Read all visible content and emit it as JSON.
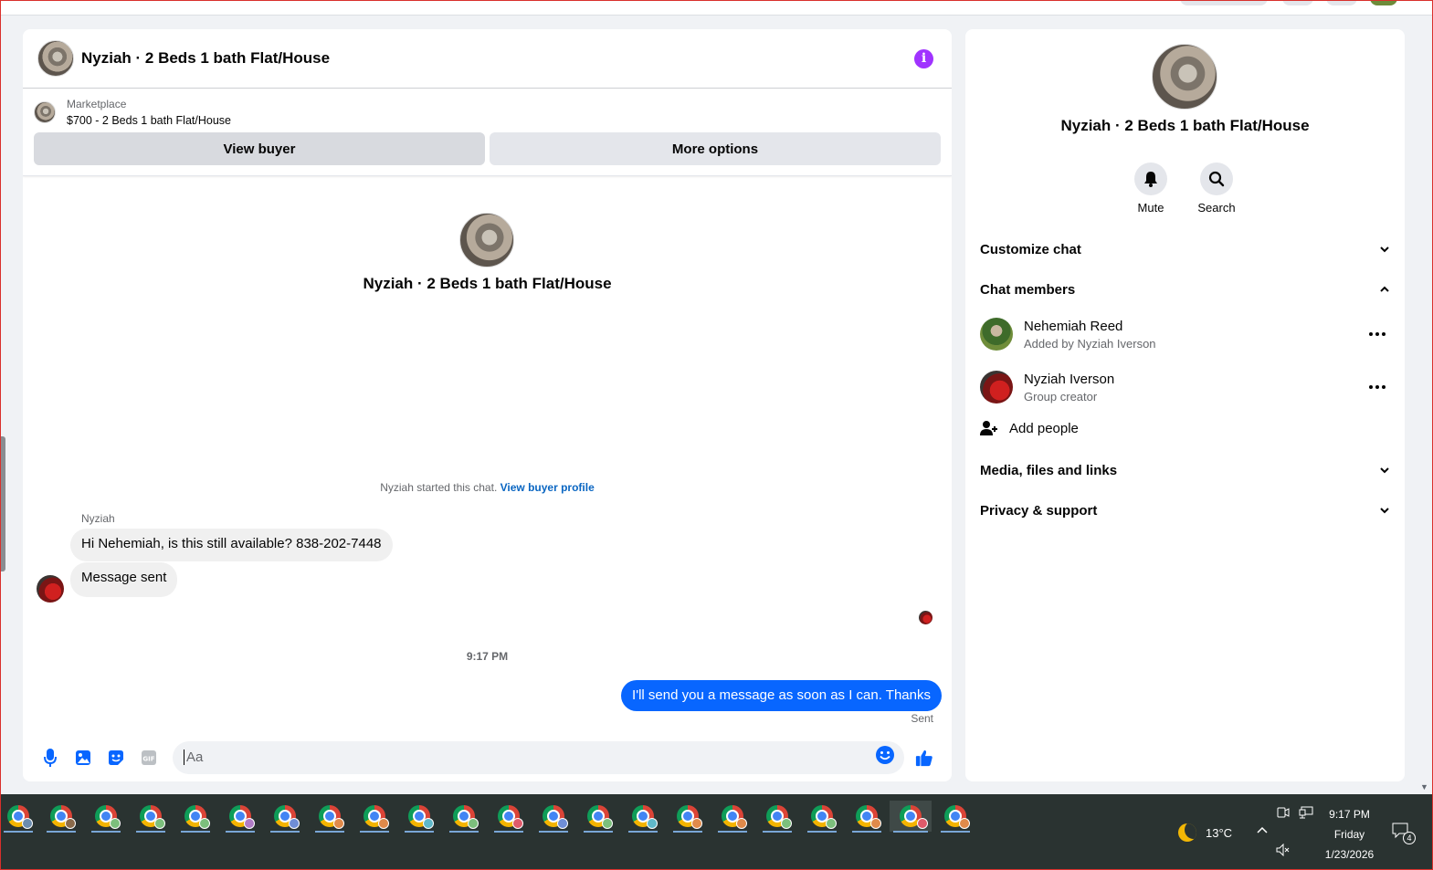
{
  "chat": {
    "title": "Nyziah · 2 Beds 1 bath Flat/House",
    "listing": {
      "category": "Marketplace",
      "description": "$700 - 2 Beds 1 bath Flat/House",
      "view_buyer_label": "View buyer",
      "more_options_label": "More options"
    },
    "intro_name": "Nyziah · 2 Beds 1 bath Flat/House",
    "started_text": "Nyziah started this chat.",
    "view_buyer_profile_link": "View buyer profile",
    "sender_name": "Nyziah",
    "messages_in": [
      "Hi Nehemiah, is this still available? 838-202-7448",
      "Message sent"
    ],
    "timestamp": "9:17 PM",
    "message_out": "I'll send you a message as soon as I can. Thanks",
    "status": "Sent",
    "composer_placeholder": "Aa",
    "icons": [
      "microphone-icon",
      "image-icon",
      "sticker-icon",
      "gif-icon",
      "emoji-icon",
      "thumbs-up-icon",
      "info-icon"
    ]
  },
  "side": {
    "name": "Nyziah · 2 Beds 1 bath Flat/House",
    "actions": [
      {
        "label": "Mute",
        "icon": "bell-icon"
      },
      {
        "label": "Search",
        "icon": "search-icon"
      }
    ],
    "sections": {
      "customize": "Customize chat",
      "members": "Chat members",
      "media": "Media, files and links",
      "privacy": "Privacy & support"
    },
    "members": [
      {
        "name": "Nehemiah Reed",
        "sub": "Added by Nyziah Iverson"
      },
      {
        "name": "Nyziah Iverson",
        "sub": "Group creator"
      }
    ],
    "add_people": "Add people"
  },
  "taskbar": {
    "weather": "13°C",
    "time": "9:17 PM",
    "day": "Friday",
    "date": "1/23/2026",
    "notification_count": "4",
    "accent": "#79a6d6"
  }
}
